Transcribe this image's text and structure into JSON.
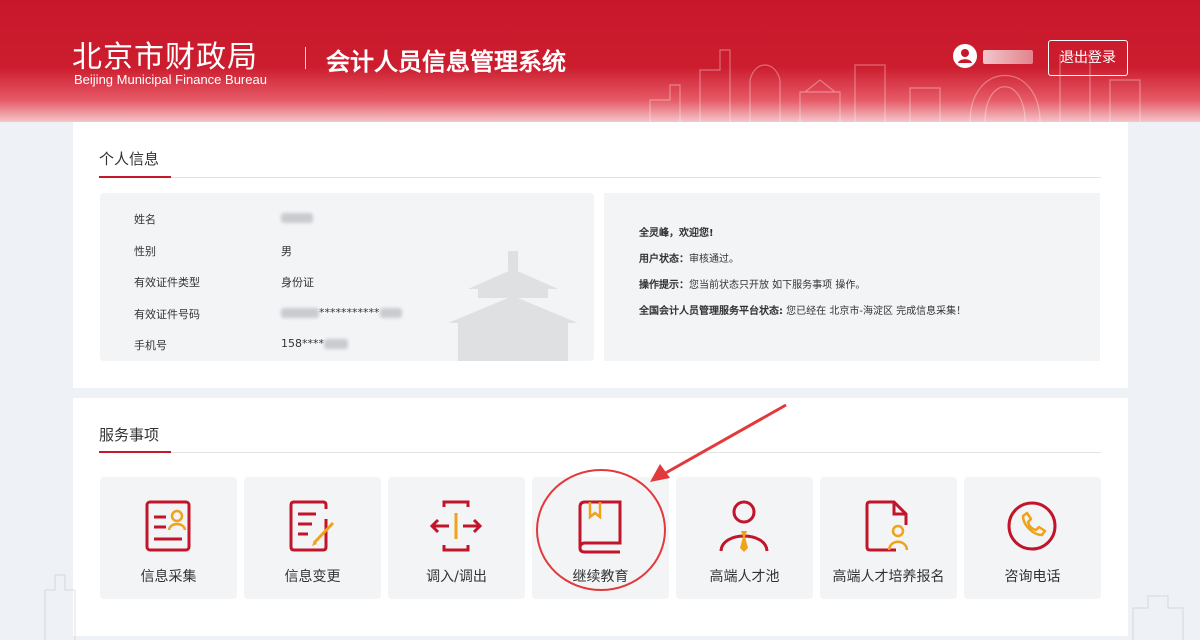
{
  "header": {
    "logo_cn": "北京市财政局",
    "logo_en": "Beijing Municipal Finance Bureau",
    "system_title": "会计人员信息管理系统",
    "logout_label": "退出登录"
  },
  "personal": {
    "section_title": "个人信息",
    "rows": [
      {
        "label": "姓名",
        "value": ""
      },
      {
        "label": "性别",
        "value": "男"
      },
      {
        "label": "有效证件类型",
        "value": "身份证"
      },
      {
        "label": "有效证件号码",
        "value": "***********"
      },
      {
        "label": "手机号",
        "value": "158****"
      }
    ],
    "status": {
      "greeting": "全灵峰，欢迎您!",
      "user_status_label": "用户状态：",
      "user_status_value": "审核通过。",
      "tip_label": "操作提示：",
      "tip_value": "您当前状态只开放 如下服务事项 操作。",
      "platform_label": "全国会计人员管理服务平台状态:",
      "platform_value": " 您已经在 北京市-海淀区 完成信息采集！"
    }
  },
  "services": {
    "section_title": "服务事项",
    "items": [
      {
        "label": "信息采集",
        "icon": "info-collection-icon"
      },
      {
        "label": "信息变更",
        "icon": "info-change-icon"
      },
      {
        "label": "调入/调出",
        "icon": "transfer-icon"
      },
      {
        "label": "继续教育",
        "icon": "book-icon"
      },
      {
        "label": "高端人才池",
        "icon": "talent-pool-icon"
      },
      {
        "label": "高端人才培养报名",
        "icon": "talent-training-icon"
      },
      {
        "label": "咨询电话",
        "icon": "phone-icon"
      }
    ]
  },
  "colors": {
    "brand_red": "#c8172a",
    "icon_red": "#c0152a",
    "icon_gold": "#f0a21a",
    "annotation_red": "#e2393c"
  }
}
